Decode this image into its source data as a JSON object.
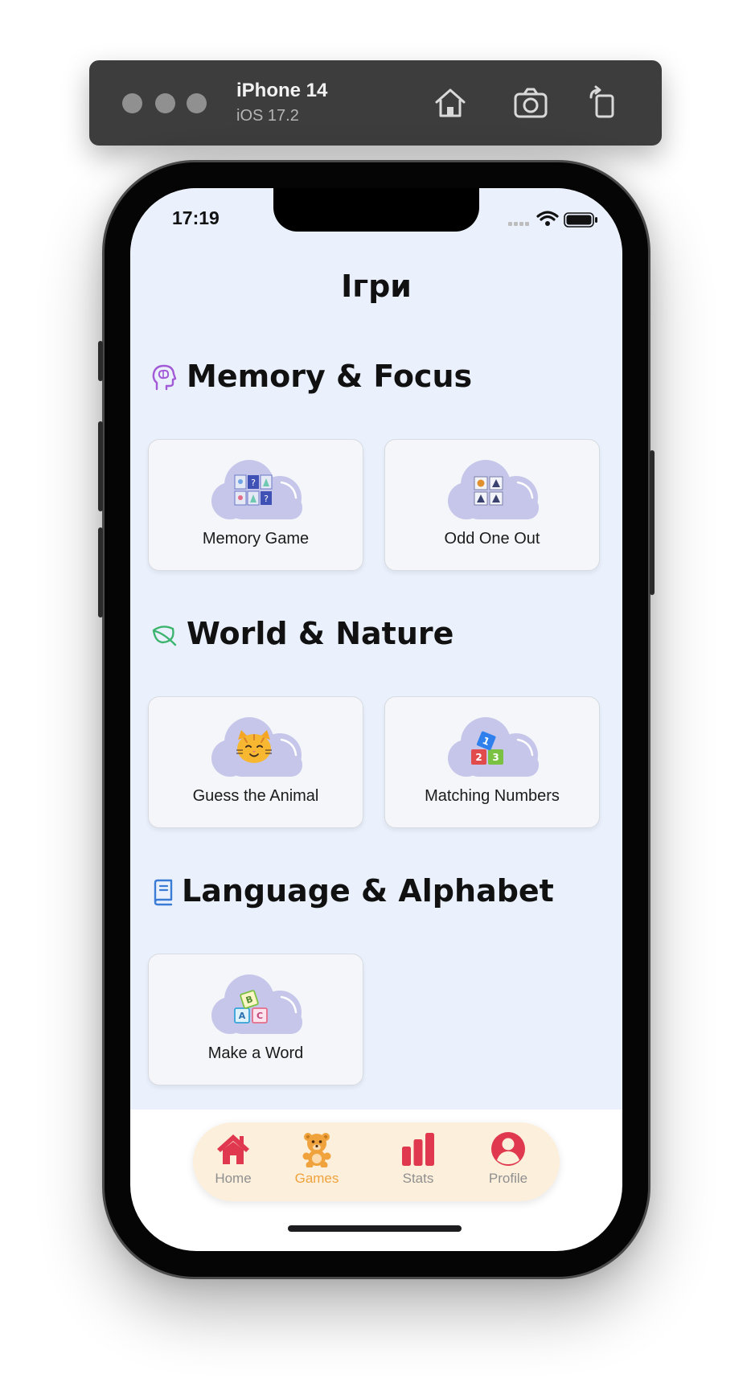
{
  "simulator": {
    "device_name": "iPhone 14",
    "os_version": "iOS 17.2",
    "buttons": [
      "home-icon",
      "screenshot-icon",
      "rotate-icon"
    ]
  },
  "status_bar": {
    "time": "17:19"
  },
  "page": {
    "title": "Ігри"
  },
  "sections": [
    {
      "title": "Memory & Focus",
      "icon": "brain-head-icon",
      "color": "#a25ad6",
      "games": [
        {
          "label": "Memory Game",
          "icon": "memory-cards-icon"
        },
        {
          "label": "Odd One Out",
          "icon": "odd-one-out-icon"
        }
      ]
    },
    {
      "title": "World & Nature",
      "icon": "leaf-icon",
      "color": "#3cb46e",
      "games": [
        {
          "label": "Guess the Animal",
          "icon": "cat-face-icon"
        },
        {
          "label": "Matching Numbers",
          "icon": "number-blocks-icon"
        }
      ]
    },
    {
      "title": "Language & Alphabet",
      "icon": "book-icon",
      "color": "#3a7bd5",
      "games": [
        {
          "label": "Make a Word",
          "icon": "letter-blocks-icon"
        }
      ]
    }
  ],
  "tab_bar": {
    "tabs": [
      {
        "label": "Home",
        "icon": "house-icon"
      },
      {
        "label": "Games",
        "icon": "teddy-bear-icon",
        "active": true
      },
      {
        "label": "Stats",
        "icon": "bar-chart-icon"
      },
      {
        "label": "Profile",
        "icon": "person-circle-icon"
      }
    ]
  },
  "colors": {
    "background": "#eaf1fd",
    "card": "#f4f6f9",
    "cloud": "#c5c6ea",
    "tab_icon": "#e0384f",
    "tab_active": "#f0a23c",
    "tab_bar": "#fcf0dd"
  }
}
